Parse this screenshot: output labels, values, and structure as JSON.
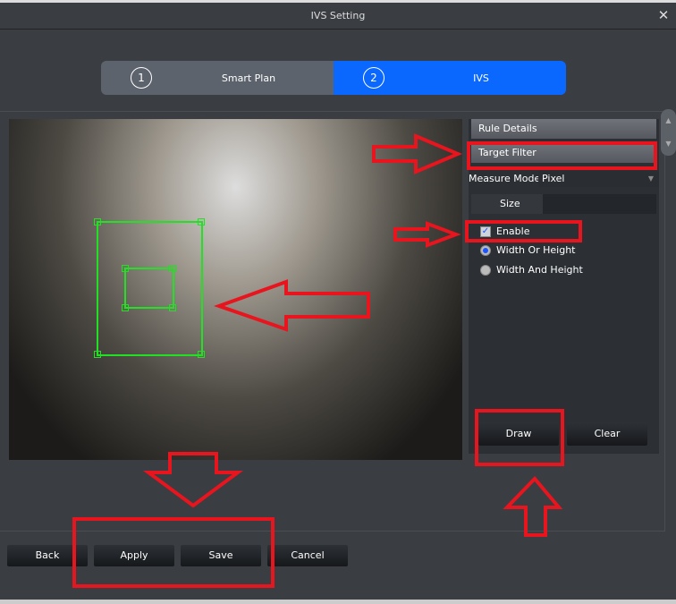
{
  "window": {
    "title": "IVS Setting",
    "close_icon": "close-icon"
  },
  "steps": [
    {
      "number": "1",
      "label": "Smart Plan"
    },
    {
      "number": "2",
      "label": "IVS"
    }
  ],
  "panel": {
    "rule_details": "Rule Details",
    "target_filter": "Target Filter",
    "measure_mode_label": "Measure Mode:",
    "measure_mode_value": "Pixel",
    "size_tab": "Size",
    "enable_label": "Enable",
    "enable_checked": true,
    "option_width_or_height": "Width Or Height",
    "option_width_and_height": "Width And Height",
    "selected_option": "Width Or Height",
    "draw": "Draw",
    "clear": "Clear"
  },
  "footer": {
    "back": "Back",
    "apply": "Apply",
    "save": "Save",
    "cancel": "Cancel"
  },
  "colors": {
    "accent": "#0b68ff",
    "detection_box": "#22e022",
    "annotation": "#e8141e"
  }
}
